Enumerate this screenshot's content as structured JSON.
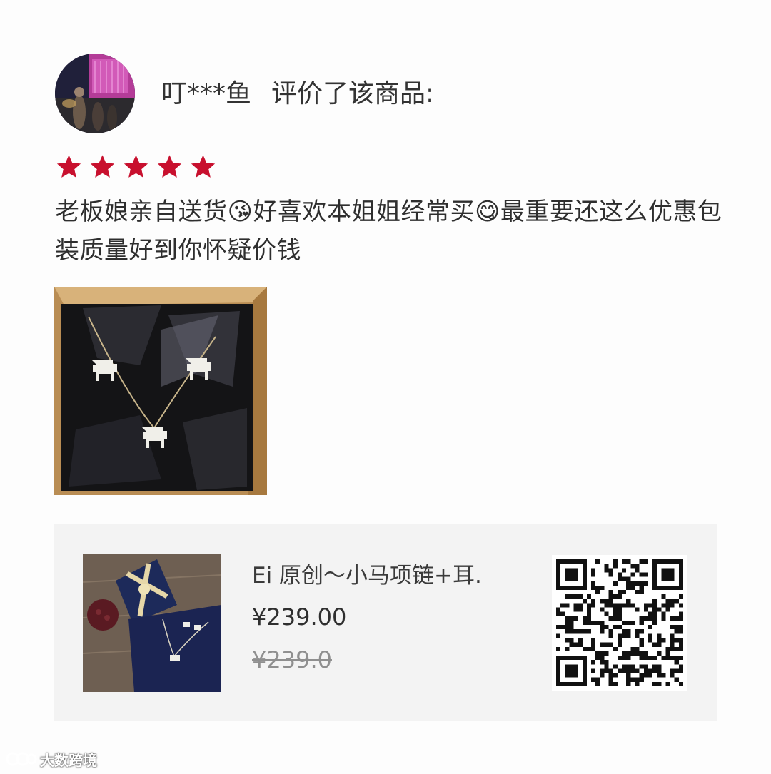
{
  "review": {
    "reviewer_name": "叮***鱼",
    "action_text": "评价了该商品:",
    "rating": 5,
    "text": "老板娘亲自送货😘好喜欢本姐姐经常买😋最重要还这么优惠包装质量好到你怀疑价钱"
  },
  "product": {
    "title": "Ei 原创～小马项链+耳.",
    "price": "¥239.00",
    "original_price": "¥239.0"
  },
  "watermark": {
    "text": "大数跨境"
  },
  "colors": {
    "star": "#c8102e",
    "card_background": "#f3f3f3"
  },
  "icons": [
    "avatar-image",
    "star-icon",
    "qr-code",
    "watermark-logo-icon"
  ]
}
